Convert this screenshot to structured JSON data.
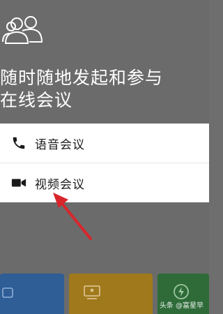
{
  "headline": {
    "line1": "随时随地发起和参与",
    "line2": "在线会议"
  },
  "options": [
    {
      "label": "语音会议",
      "icon": "phone-icon"
    },
    {
      "label": "视频会议",
      "icon": "video-camera-icon"
    }
  ],
  "tiles": [
    {
      "icon": "calendar-icon",
      "color": "#2f5d96"
    },
    {
      "icon": "screen-share-icon",
      "color": "#a0791c"
    },
    {
      "icon": "lightning-icon",
      "color": "#2e6b38"
    }
  ],
  "watermark": "头条 @富星早",
  "colors": {
    "dim_overlay": "#6b6b6b",
    "sheet_background": "#ffffff",
    "annotation_arrow": "#d8262c"
  }
}
